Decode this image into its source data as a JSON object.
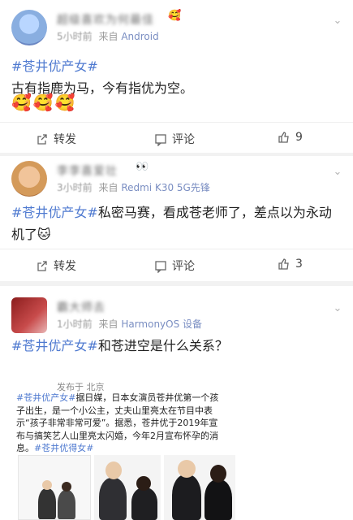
{
  "posts": [
    {
      "user": "超级喜欢为何最佳",
      "time": "5小时前",
      "source_prefix": "来自",
      "source": "Android",
      "tag": "#苍井优产女#",
      "text": "古有指鹿为马，今有指优为空。",
      "emoji": "🥰🥰🥰",
      "actions": {
        "repost": "转发",
        "comment": "评论",
        "like_count": "9"
      }
    },
    {
      "user": "李李喜爱壮",
      "time": "3小时前",
      "source_prefix": "来自",
      "source": "Redmi K30 5G先锋",
      "tag": "#苍井优产女#",
      "text": "私密马赛，看成苍老师了，差点以为永动机了",
      "emoji": "🐱",
      "actions": {
        "repost": "转发",
        "comment": "评论",
        "like_count": "3"
      }
    },
    {
      "user": "霸大师去",
      "time": "1小时前",
      "source_prefix": "来自",
      "source": "HarmonyOS 设备",
      "tag": "#苍井优产女#",
      "text": "和苍进空是什么关系？",
      "embed": {
        "published": "发布于 北京",
        "tag_start": "#苍井优产女#",
        "body": "据日媒，日本女演员苍井优第一个孩子出生，是一个小公主，丈夫山里亮太在节目中表示“孩子非常非常可爱”。据悉，苍井优于2019年宣布与搞笑艺人山里亮太闪婚，今年2月宣布怀孕的消息。",
        "tag_end": "#苍井优得女#"
      }
    }
  ]
}
